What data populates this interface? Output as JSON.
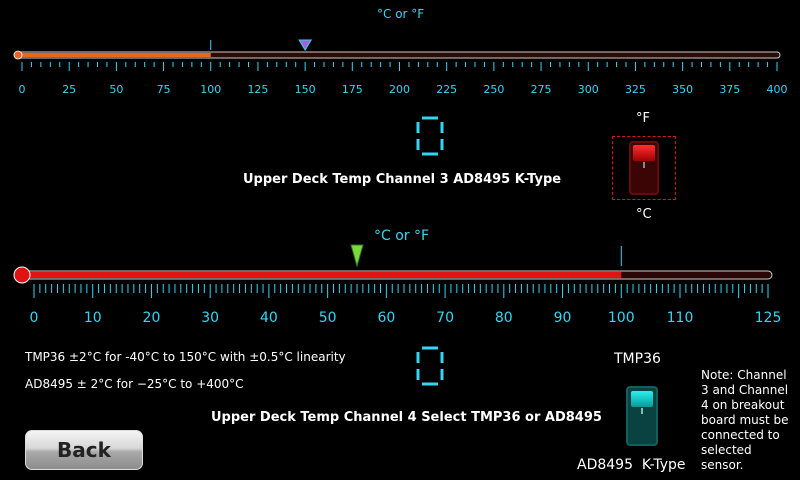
{
  "gauge1": {
    "unit_label": "°C or °F",
    "min": 0,
    "max": 400,
    "value": 100,
    "pointer_value": 150,
    "tick_labels": [
      "0",
      "25",
      "50",
      "75",
      "100",
      "125",
      "150",
      "175",
      "200",
      "225",
      "250",
      "275",
      "300",
      "325",
      "350",
      "375",
      "400"
    ],
    "readout": "0",
    "title": "Upper Deck Temp Channel 3 AD8495 K-Type",
    "fill_color": "#e8661e",
    "pointer_color": "#a062d8"
  },
  "unit_switch": {
    "top_label": "°F",
    "bottom_label": "°C",
    "color": "#c41010"
  },
  "gauge2": {
    "unit_label": "°C or °F",
    "min": 0,
    "max": 125,
    "value": 100,
    "pointer_value": 55,
    "tick_labels": [
      "0",
      "10",
      "20",
      "30",
      "40",
      "50",
      "60",
      "70",
      "80",
      "90",
      "100",
      "110",
      "125"
    ],
    "readout": "0",
    "title": "Upper Deck Temp Channel 4 Select TMP36 or AD8495",
    "fill_color": "#e01414",
    "pointer_color": "#7ed83a"
  },
  "specs": {
    "tmp36": "TMP36 ±2°C for -40°C to 150°C with ±0.5°C linearity",
    "ad8495": "AD8495 ± 2°C for −25°C to +400°C"
  },
  "sensor_switch": {
    "top_label": "TMP36",
    "bottom_label": "AD8495  K-Type",
    "color": "#1fd6d6"
  },
  "note": "Note: Channel 3 and Channel 4 on breakout board must be connected to selected sensor.",
  "back_label": "Back"
}
